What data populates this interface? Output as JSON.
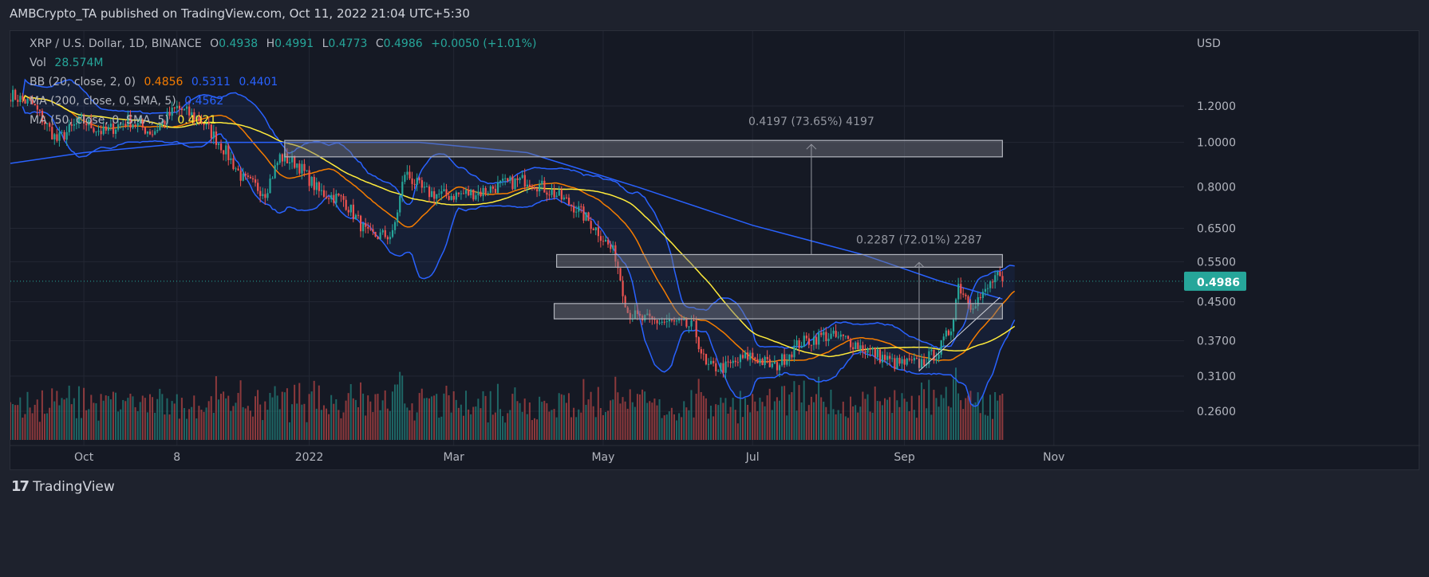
{
  "header": {
    "published": "AMBCrypto_TA published on TradingView.com, Oct 11, 2022 21:04 UTC+5:30"
  },
  "legend": {
    "symbol": "XRP / U.S. Dollar, 1D, BINANCE",
    "o_label": "O",
    "o": "0.4938",
    "h_label": "H",
    "h": "0.4991",
    "l_label": "L",
    "l": "0.4773",
    "c_label": "C",
    "c": "0.4986",
    "change": "+0.0050 (+1.01%)",
    "vol_label": "Vol",
    "vol": "28.574M",
    "bb_label": "BB (20, close, 2, 0)",
    "bb_basis": "0.4856",
    "bb_upper": "0.5311",
    "bb_lower": "0.4401",
    "ma200_label": "MA (200, close, 0, SMA, 5)",
    "ma200": "0.4562",
    "ma50_label": "MA (50, close, 0, SMA, 5)",
    "ma50": "0.4021"
  },
  "footer": {
    "brand": "TradingView",
    "logo_text": "17"
  },
  "colors": {
    "up": "#26a69a",
    "down": "#ef5350",
    "bb_basis": "#f57c00",
    "bb_bands": "#2962ff",
    "ma200": "#2962ff",
    "ma50": "#ffeb3b",
    "last_price_bg": "#26a69a",
    "grid": "#232733"
  },
  "chart_data": {
    "type": "candlestick",
    "symbol": "XRP / U.S. Dollar",
    "interval": "1D",
    "y_scale": "log",
    "y_unit": "USD",
    "grid": true,
    "yticks": [
      1.2,
      1.0,
      0.8,
      0.65,
      0.55,
      0.45,
      0.37,
      0.31,
      0.26
    ],
    "ytick_labels": [
      "1.2000",
      "1.0000",
      "0.8000",
      "0.6500",
      "0.5500",
      "0.4500",
      "0.3700",
      "0.3100",
      "0.2600"
    ],
    "xticks": [
      {
        "date": "2021-10-01",
        "label": "Oct"
      },
      {
        "date": "2021-11-08",
        "label": "8"
      },
      {
        "date": "2022-01-01",
        "label": "2022"
      },
      {
        "date": "2022-03-01",
        "label": "Mar"
      },
      {
        "date": "2022-05-01",
        "label": "May"
      },
      {
        "date": "2022-07-01",
        "label": "Jul"
      },
      {
        "date": "2022-09-01",
        "label": "Sep"
      },
      {
        "date": "2022-11-01",
        "label": "Nov"
      }
    ],
    "last_price": 0.4986,
    "last_price_label": "0.4986",
    "close_path": [
      [
        "2021-09-01",
        1.27
      ],
      [
        "2021-09-10",
        1.21
      ],
      [
        "2021-09-20",
        1.01
      ],
      [
        "2021-09-30",
        1.117
      ],
      [
        "2021-10-09",
        1.05
      ],
      [
        "2021-10-19",
        1.117
      ],
      [
        "2021-10-29",
        1.05
      ],
      [
        "2021-11-08",
        1.19
      ],
      [
        "2021-11-18",
        1.117
      ],
      [
        "2021-11-27",
        0.97
      ],
      [
        "2021-12-05",
        0.83
      ],
      [
        "2021-12-14",
        0.78
      ],
      [
        "2021-12-20",
        0.93
      ],
      [
        "2021-12-27",
        0.9
      ],
      [
        "2022-01-05",
        0.78
      ],
      [
        "2022-01-15",
        0.75
      ],
      [
        "2022-01-25",
        0.627
      ],
      [
        "2022-02-04",
        0.627
      ],
      [
        "2022-02-09",
        0.86
      ],
      [
        "2022-02-17",
        0.78
      ],
      [
        "2022-02-26",
        0.765
      ],
      [
        "2022-03-12",
        0.78
      ],
      [
        "2022-03-21",
        0.81
      ],
      [
        "2022-03-31",
        0.83
      ],
      [
        "2022-04-10",
        0.78
      ],
      [
        "2022-04-20",
        0.72
      ],
      [
        "2022-04-29",
        0.64
      ],
      [
        "2022-05-06",
        0.567
      ],
      [
        "2022-05-11",
        0.428
      ],
      [
        "2022-05-16",
        0.412
      ],
      [
        "2022-05-29",
        0.405
      ],
      [
        "2022-06-07",
        0.396
      ],
      [
        "2022-06-12",
        0.324
      ],
      [
        "2022-06-20",
        0.324
      ],
      [
        "2022-06-30",
        0.344
      ],
      [
        "2022-07-10",
        0.324
      ],
      [
        "2022-07-20",
        0.365
      ],
      [
        "2022-07-30",
        0.38
      ],
      [
        "2022-08-08",
        0.373
      ],
      [
        "2022-08-18",
        0.351
      ],
      [
        "2022-08-28",
        0.33
      ],
      [
        "2022-09-07",
        0.33
      ],
      [
        "2022-09-15",
        0.351
      ],
      [
        "2022-09-20",
        0.396
      ],
      [
        "2022-09-23",
        0.49
      ],
      [
        "2022-09-28",
        0.446
      ],
      [
        "2022-10-03",
        0.463
      ],
      [
        "2022-10-08",
        0.51
      ],
      [
        "2022-10-11",
        0.4986
      ]
    ],
    "ma200_path": [
      [
        "2021-09-01",
        0.9
      ],
      [
        "2021-10-01",
        0.95
      ],
      [
        "2021-11-15",
        1.0
      ],
      [
        "2022-01-01",
        1.0
      ],
      [
        "2022-02-15",
        1.0
      ],
      [
        "2022-03-31",
        0.95
      ],
      [
        "2022-05-15",
        0.8
      ],
      [
        "2022-07-01",
        0.66
      ],
      [
        "2022-08-15",
        0.57
      ],
      [
        "2022-09-15",
        0.5
      ],
      [
        "2022-10-11",
        0.4562
      ]
    ],
    "zones": [
      {
        "from": "2021-12-22",
        "to": "2022-10-11",
        "top": 1.01,
        "bottom": 0.93
      },
      {
        "from": "2022-04-12",
        "to": "2022-10-11",
        "top": 0.57,
        "bottom": 0.535
      },
      {
        "from": "2022-04-11",
        "to": "2022-10-11",
        "top": 0.446,
        "bottom": 0.413
      }
    ],
    "measures": [
      {
        "date": "2022-07-25",
        "from": 0.57,
        "to": 0.99,
        "label": "0.4197 (73.65%) 4197"
      },
      {
        "date": "2022-09-07",
        "from": 0.318,
        "to": 0.548,
        "label": "0.2287 (72.01%) 2287"
      }
    ],
    "trendline": {
      "from": [
        "2022-09-07",
        0.318
      ],
      "to": [
        "2022-10-10",
        0.46
      ]
    }
  }
}
